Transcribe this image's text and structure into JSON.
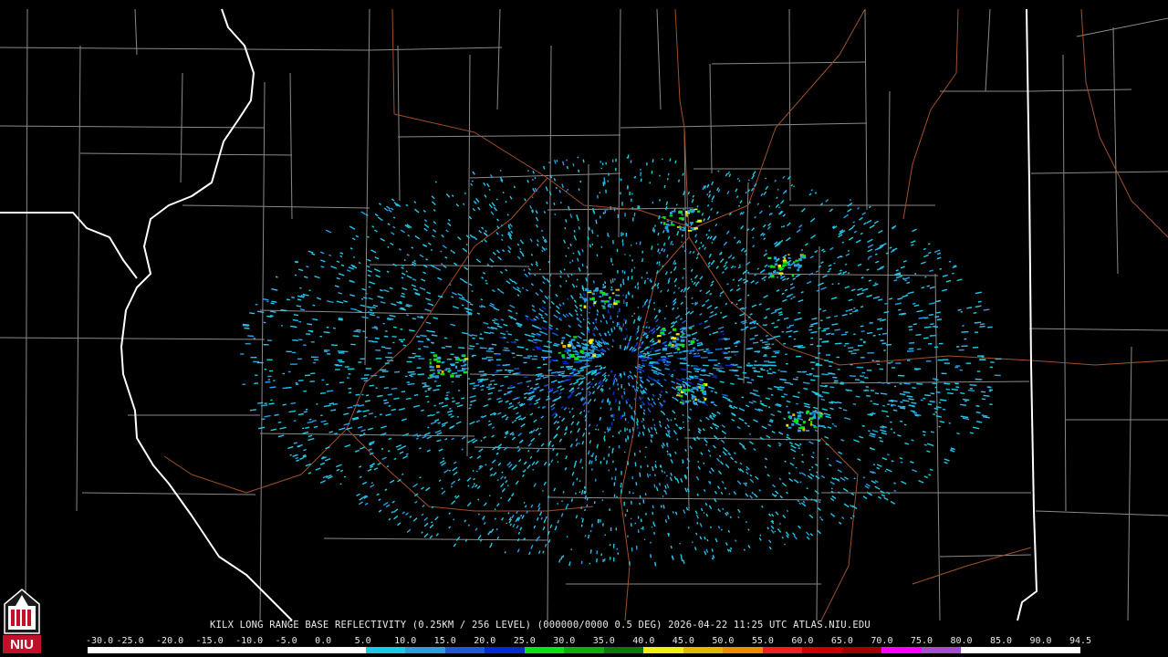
{
  "product": {
    "caption": "KILX LONG RANGE BASE REFLECTIVITY (0.25KM / 256 LEVEL) (000000/0000 0.5 DEG) 2026-04-22 11:25 UTC  ATLAS.NIU.EDU",
    "radar_site": "KILX",
    "timestamp_utc": "2026-04-22 11:25 UTC",
    "source": "ATLAS.NIU.EDU",
    "logo_text": "NIU"
  },
  "color_scale": {
    "labels": [
      "-30.0",
      "-25.0",
      "-20.0",
      "-15.0",
      "-10.0",
      "-5.0",
      "0.0",
      "5.0",
      "10.0",
      "15.0",
      "20.0",
      "25.0",
      "30.0",
      "35.0",
      "40.0",
      "45.0",
      "50.0",
      "55.0",
      "60.0",
      "65.0",
      "70.0",
      "75.0",
      "80.0",
      "85.0",
      "90.0",
      "94.5"
    ],
    "colors": [
      "#ffffff",
      "#ffffff",
      "#ffffff",
      "#ffffff",
      "#ffffff",
      "#ffffff",
      "#ffffff",
      "#20c8e8",
      "#2a9ee0",
      "#1e5ad8",
      "#0a2ad0",
      "#10e010",
      "#08b008",
      "#0a7a0a",
      "#f0f010",
      "#e0b800",
      "#f08800",
      "#f02020",
      "#c80000",
      "#a00000",
      "#ff00ff",
      "#a050d0",
      "#ffffff",
      "#ffffff",
      "#ffffff"
    ]
  },
  "map_colors": {
    "background": "#000000",
    "county_lines": "#8a8a8a",
    "state_lines": "#ffffff",
    "highways": "#a0502a"
  }
}
